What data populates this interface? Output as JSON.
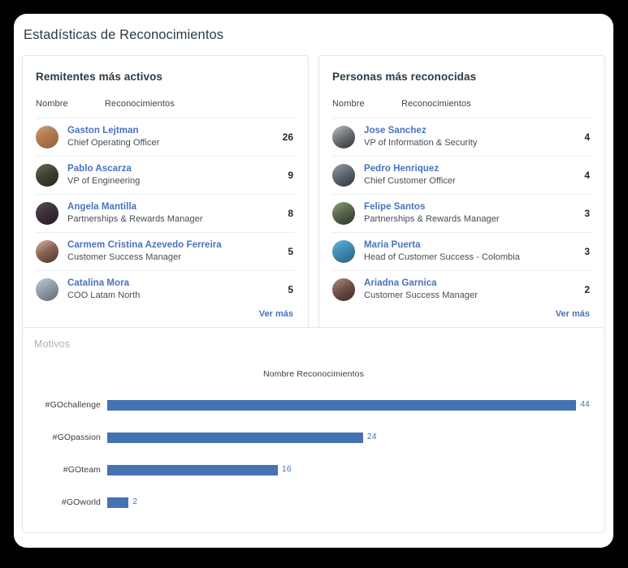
{
  "page": {
    "title": "Estadísticas de Reconocimientos"
  },
  "colors": {
    "link": "#4a72bb",
    "bar": "#4573b1",
    "title": "#2d3b45",
    "muted": "#aeb1b4"
  },
  "senders_card": {
    "title": "Remitentes más activos",
    "col_name": "Nombre",
    "col_count": "Reconocimientos",
    "see_more": "Ver más",
    "rows": [
      {
        "name": "Gaston Lejtman",
        "role": "Chief Operating Officer",
        "count": "26"
      },
      {
        "name": "Pablo Ascarza",
        "role": "VP of Engineering",
        "count": "9"
      },
      {
        "name": "Angela Mantilla",
        "role": "Partnerships & Rewards Manager",
        "count": "8"
      },
      {
        "name": "Carmem Cristina Azevedo Ferreira",
        "role": "Customer Success Manager",
        "count": "5"
      },
      {
        "name": "Catalina Mora",
        "role": "COO Latam North",
        "count": "5"
      }
    ]
  },
  "recognized_card": {
    "title": "Personas más reconocidas",
    "col_name": "Nombre",
    "col_count": "Reconocimientos",
    "see_more": "Ver más",
    "rows": [
      {
        "name": "Jose Sanchez",
        "role": "VP of Information & Security",
        "count": "4"
      },
      {
        "name": "Pedro Henriquez",
        "role": "Chief Customer Officer",
        "count": "4"
      },
      {
        "name": "Felipe Santos",
        "role": "Partnerships & Rewards Manager",
        "count": "3"
      },
      {
        "name": "Maria Puerta",
        "role": "Head of Customer Success - Colombia",
        "count": "3"
      },
      {
        "name": "Ariadna Garnica",
        "role": "Customer Success Manager",
        "count": "2"
      }
    ]
  },
  "motivos_card": {
    "label": "Motivos"
  },
  "chart_data": {
    "type": "bar",
    "orientation": "horizontal",
    "title": "Nombre  Reconocimientos",
    "xlabel": "",
    "ylabel": "",
    "categories": [
      "#GOchallenge",
      "#GOpassion",
      "#GOteam",
      "#GOworld"
    ],
    "values": [
      44,
      24,
      16,
      2
    ],
    "value_labels": [
      "44",
      "24",
      "16",
      "2"
    ],
    "xlim": [
      0,
      44
    ],
    "grid": false,
    "legend": false,
    "bar_color": "#4573b1",
    "data_label_color": "#4573b1"
  }
}
